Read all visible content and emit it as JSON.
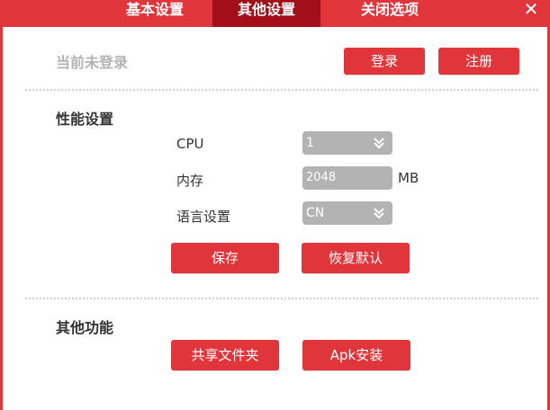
{
  "tabs": [
    {
      "label": "基本设置",
      "active": false
    },
    {
      "label": "其他设置",
      "active": true
    },
    {
      "label": "关闭选项",
      "active": false
    }
  ],
  "close_glyph": "✕",
  "account": {
    "status": "当前未登录",
    "login_label": "登录",
    "register_label": "注册"
  },
  "performance": {
    "title": "性能设置",
    "cpu_label": "CPU",
    "cpu_value": "1",
    "memory_label": "内存",
    "memory_value": "2048",
    "memory_unit": "MB",
    "language_label": "语言设置",
    "language_value": "CN",
    "save_label": "保存",
    "restore_label": "恢复默认"
  },
  "other": {
    "title": "其他功能",
    "share_label": "共享文件夹",
    "apk_label": "Apk安装"
  },
  "colors": {
    "accent": "#e0353a",
    "active_tab": "#a30f19",
    "field_bg": "#b3b3b3"
  }
}
